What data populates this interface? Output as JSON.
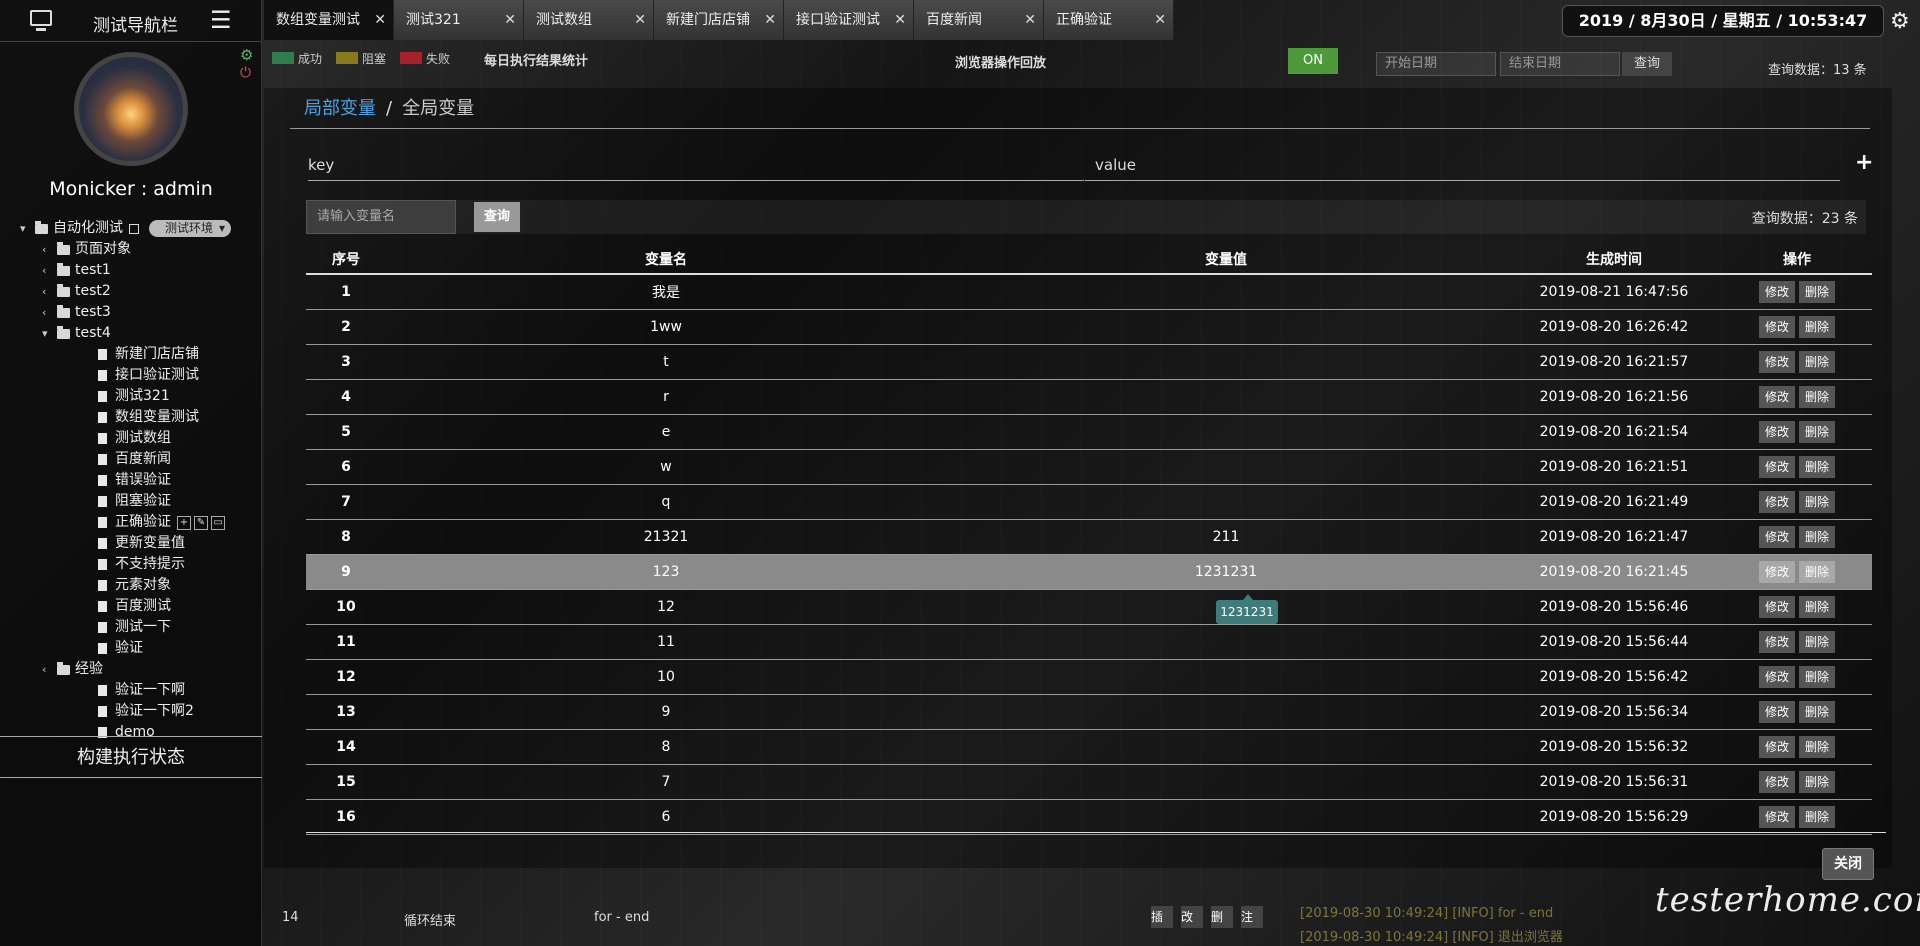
{
  "sidebar": {
    "title": "测试导航栏",
    "username": "Monicker : admin",
    "tree": [
      {
        "label": "自动化测试",
        "type": "folder",
        "indent": 0,
        "open": true
      },
      {
        "label": "页面对象",
        "type": "folder",
        "indent": 1
      },
      {
        "label": "test1",
        "type": "folder",
        "indent": 1
      },
      {
        "label": "test2",
        "type": "folder",
        "indent": 1
      },
      {
        "label": "test3",
        "type": "folder",
        "indent": 1
      },
      {
        "label": "test4",
        "type": "folder",
        "indent": 1,
        "open": true
      },
      {
        "label": "新建门店店铺",
        "type": "doc",
        "indent": 2
      },
      {
        "label": "接口验证测试",
        "type": "doc",
        "indent": 2
      },
      {
        "label": "测试321",
        "type": "doc",
        "indent": 2
      },
      {
        "label": "数组变量测试",
        "type": "doc",
        "indent": 2
      },
      {
        "label": "测试数组",
        "type": "doc",
        "indent": 2
      },
      {
        "label": "百度新闻",
        "type": "doc",
        "indent": 2
      },
      {
        "label": "错误验证",
        "type": "doc",
        "indent": 2
      },
      {
        "label": "阻塞验证",
        "type": "doc",
        "indent": 2
      },
      {
        "label": "正确验证",
        "type": "doc",
        "indent": 2
      },
      {
        "label": "更新变量值",
        "type": "doc",
        "indent": 2
      },
      {
        "label": "不支持提示",
        "type": "doc",
        "indent": 2
      },
      {
        "label": "元素对象",
        "type": "doc",
        "indent": 2
      },
      {
        "label": "百度测试",
        "type": "doc",
        "indent": 2
      },
      {
        "label": "测试一下",
        "type": "doc",
        "indent": 2
      },
      {
        "label": "验证",
        "type": "doc",
        "indent": 2
      },
      {
        "label": "经验",
        "type": "folder",
        "indent": 1
      },
      {
        "label": "验证一下啊",
        "type": "doc",
        "indent": 2
      },
      {
        "label": "验证一下啊2",
        "type": "doc",
        "indent": 2
      },
      {
        "label": "demo",
        "type": "doc",
        "indent": 2
      }
    ],
    "env_select": "测试环境",
    "build_status": "构建执行状态"
  },
  "tabs": [
    {
      "label": "数组变量测试",
      "active": true
    },
    {
      "label": "测试321"
    },
    {
      "label": "测试数组"
    },
    {
      "label": "新建门店店铺"
    },
    {
      "label": "接口验证测试"
    },
    {
      "label": "百度新闻"
    },
    {
      "label": "正确验证"
    }
  ],
  "clock": "2019 / 8月30日 / 星期五 / 10:53:47",
  "behind": {
    "legend": [
      "成功",
      "阻塞",
      "失败"
    ],
    "legend_colors": [
      "#2e7d4f",
      "#8a7a1e",
      "#a8202c"
    ],
    "daily_title": "每日执行结果统计",
    "replay_title": "浏览器操作回放",
    "on_label": "ON",
    "start_date": "开始日期",
    "end_date": "结束日期",
    "query": "查询",
    "count13": "查询数据：13 条",
    "row14": {
      "no": "14",
      "name": "循环结束",
      "action": "for - end",
      "ops": [
        "插",
        "改",
        "删",
        "注"
      ]
    },
    "log_bottom": [
      "[2019-08-30 10:49:24] [INFO] for - end",
      "[2019-08-30 10:49:24] [INFO] 退出浏览器"
    ]
  },
  "modal": {
    "crumb_active": "局部变量",
    "crumb_sep": "/",
    "crumb_other": "全局变量",
    "key_label": "key",
    "value_label": "value",
    "search_placeholder": "请输入变量名",
    "search_button": "查询",
    "count": "查询数据：23 条",
    "headers": {
      "no": "序号",
      "name": "变量名",
      "value": "变量值",
      "time": "生成时间",
      "op": "操作"
    },
    "edit_label": "修改",
    "delete_label": "删除",
    "rows": [
      {
        "no": "1",
        "name": "我是",
        "value": "",
        "time": "2019-08-21 16:47:56"
      },
      {
        "no": "2",
        "name": "1ww",
        "value": "",
        "time": "2019-08-20 16:26:42"
      },
      {
        "no": "3",
        "name": "t",
        "value": "",
        "time": "2019-08-20 16:21:57"
      },
      {
        "no": "4",
        "name": "r",
        "value": "",
        "time": "2019-08-20 16:21:56"
      },
      {
        "no": "5",
        "name": "e",
        "value": "",
        "time": "2019-08-20 16:21:54"
      },
      {
        "no": "6",
        "name": "w",
        "value": "",
        "time": "2019-08-20 16:21:51"
      },
      {
        "no": "7",
        "name": "q",
        "value": "",
        "time": "2019-08-20 16:21:49"
      },
      {
        "no": "8",
        "name": "21321",
        "value": "211",
        "time": "2019-08-20 16:21:47"
      },
      {
        "no": "9",
        "name": "123",
        "value": "1231231",
        "time": "2019-08-20 16:21:45",
        "highlight": true
      },
      {
        "no": "10",
        "name": "12",
        "value": "",
        "time": "2019-08-20 15:56:46"
      },
      {
        "no": "11",
        "name": "11",
        "value": "",
        "time": "2019-08-20 15:56:44"
      },
      {
        "no": "12",
        "name": "10",
        "value": "",
        "time": "2019-08-20 15:56:42"
      },
      {
        "no": "13",
        "name": "9",
        "value": "",
        "time": "2019-08-20 15:56:34"
      },
      {
        "no": "14",
        "name": "8",
        "value": "",
        "time": "2019-08-20 15:56:32"
      },
      {
        "no": "15",
        "name": "7",
        "value": "",
        "time": "2019-08-20 15:56:31"
      },
      {
        "no": "16",
        "name": "6",
        "value": "",
        "time": "2019-08-20 15:56:29"
      }
    ],
    "tooltip": "1231231",
    "close": "关闭"
  },
  "watermark": "testerhome.com"
}
